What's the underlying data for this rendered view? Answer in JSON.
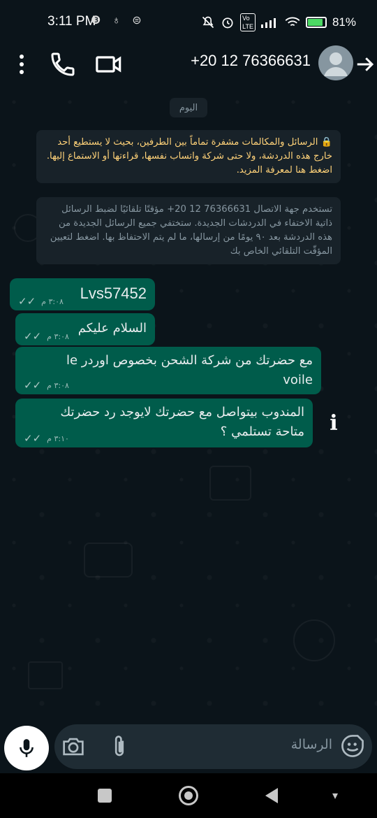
{
  "statusbar": {
    "time": "3:11 PM",
    "left_icons": "❸ ♁ ⊜",
    "battery_percent": "81%",
    "battery_level": 0.81
  },
  "header": {
    "contact_name": "+20 12 76366631",
    "icons": [
      "more-vert-icon",
      "phone-icon",
      "video-call-icon",
      "avatar-icon",
      "back-arrow-icon"
    ]
  },
  "chat": {
    "date_chip": "اليوم",
    "encryption_notice": "🔒 الرسائل والمكالمات مشفرة تماماً بين الطرفين، بحيث لا يستطيع أحد خارج هذه الدردشة، ولا حتى شركة واتساب نفسها، قراءتها أو الاستماع إليها. اضغط هنا لمعرفة المزيد.",
    "disappearing_notice": "تستخدم جهة الاتصال ‎+20 12 76366631‎ مؤقتًا تلقائيًا لضبط الرسائل ذاتية الاختفاء في الدردشات الجديدة. ستختفي جميع الرسائل الجديدة من هذه الدردشة بعد ٩٠ يومًا من إرسالها، ما لم يتم الاحتفاظ بها. اضغط لتعيين المؤقّت التلقائي الخاص بك",
    "messages": [
      {
        "text": "Lvs57452",
        "time": "٣:٠٨ م",
        "ticks": "✓✓"
      },
      {
        "text": "السلام عليكم",
        "time": "٣:٠٨ م",
        "ticks": "✓✓"
      },
      {
        "text": "مع حضرتك من شركة الشحن بخصوص اوردر le voile",
        "time": "٣:٠٨ م",
        "ticks": "✓✓"
      },
      {
        "text": "المندوب بيتواصل مع حضرتك لايوجد رد حضرتك متاحة تستلمي ؟",
        "time": "٣:١٠ م",
        "ticks": "✓✓"
      }
    ],
    "info_icon": "i"
  },
  "composer": {
    "placeholder": "الرسالة",
    "icons": [
      "mic-icon",
      "camera-icon",
      "attach-icon",
      "emoji-icon"
    ]
  },
  "colors": {
    "background": "#0b141a",
    "outgoing_bubble": "#005c4b",
    "system_bubble": "#182229",
    "encryption_text": "#ffd279",
    "secondary_text": "#8696a0",
    "input_bg": "#1f2c34"
  }
}
